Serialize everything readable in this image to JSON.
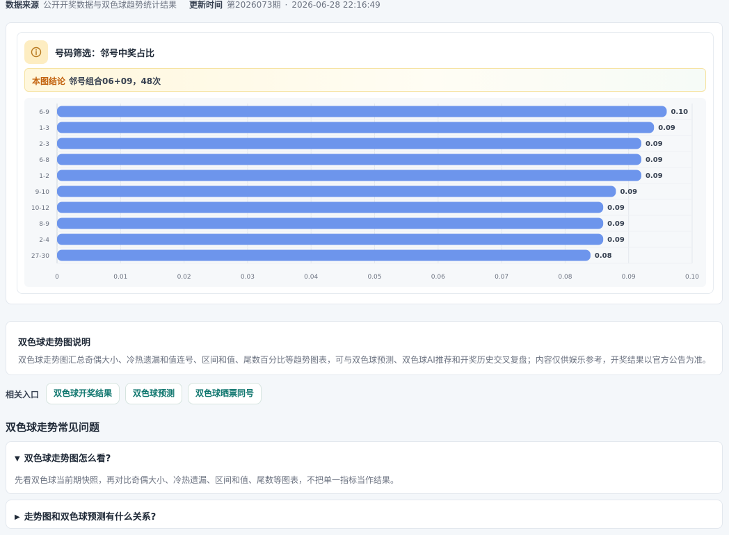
{
  "meta": {
    "source_label": "数据来源",
    "source_value": "公开开奖数据与双色球趋势统计结果",
    "update_label": "更新时间",
    "issue": "第2026073期",
    "separator": "·",
    "datetime": "2026-06-28 22:16:49"
  },
  "card": {
    "icon": "info-icon",
    "title": "号码筛选：邻号中奖占比",
    "conclusion_label": "本图结论",
    "conclusion_text": "邻号组合06+09，48次"
  },
  "chart_data": {
    "type": "bar",
    "orientation": "horizontal",
    "categories": [
      "6-9",
      "1-3",
      "2-3",
      "6-8",
      "1-2",
      "9-10",
      "10-12",
      "8-9",
      "2-4",
      "27-30"
    ],
    "values": [
      0.096,
      0.094,
      0.092,
      0.092,
      0.092,
      0.088,
      0.086,
      0.086,
      0.086,
      0.084
    ],
    "value_labels": [
      "0.10",
      "0.09",
      "0.09",
      "0.09",
      "0.09",
      "0.09",
      "0.09",
      "0.09",
      "0.09",
      "0.08"
    ],
    "xlim": [
      0,
      0.1
    ],
    "x_ticks": [
      "0",
      "0.01",
      "0.02",
      "0.03",
      "0.04",
      "0.05",
      "0.06",
      "0.07",
      "0.08",
      "0.09",
      "0.10"
    ],
    "bar_color": "#6d95ec",
    "grid": "vertical",
    "title": "",
    "xlabel": "",
    "ylabel": ""
  },
  "explain": {
    "title": "双色球走势图说明",
    "text": "双色球走势图汇总奇偶大小、冷热遗漏和值连号、区间和值、尾数百分比等趋势图表，可与双色球预测、双色球AI推荐和开奖历史交叉复盘；内容仅供娱乐参考，开奖结果以官方公告为准。"
  },
  "related": {
    "label": "相关入口",
    "links": [
      "双色球开奖结果",
      "双色球预测",
      "双色球晒票同号"
    ]
  },
  "faq": {
    "heading": "双色球走势常见问题",
    "items": [
      {
        "question": "双色球走势图怎么看?",
        "answer": "先看双色球当前期快照，再对比奇偶大小、冷热遗漏、区间和值、尾数等图表，不把单一指标当作结果。",
        "open_marker": "▼"
      },
      {
        "question": "走势图和双色球预测有什么关系?",
        "closed_marker": "▶"
      }
    ]
  },
  "colors": {
    "accent_teal": "#0f766e",
    "conclusion_label": "#c2610c",
    "icon_bg": "#fdedc2",
    "icon_stroke": "#b7791f"
  }
}
